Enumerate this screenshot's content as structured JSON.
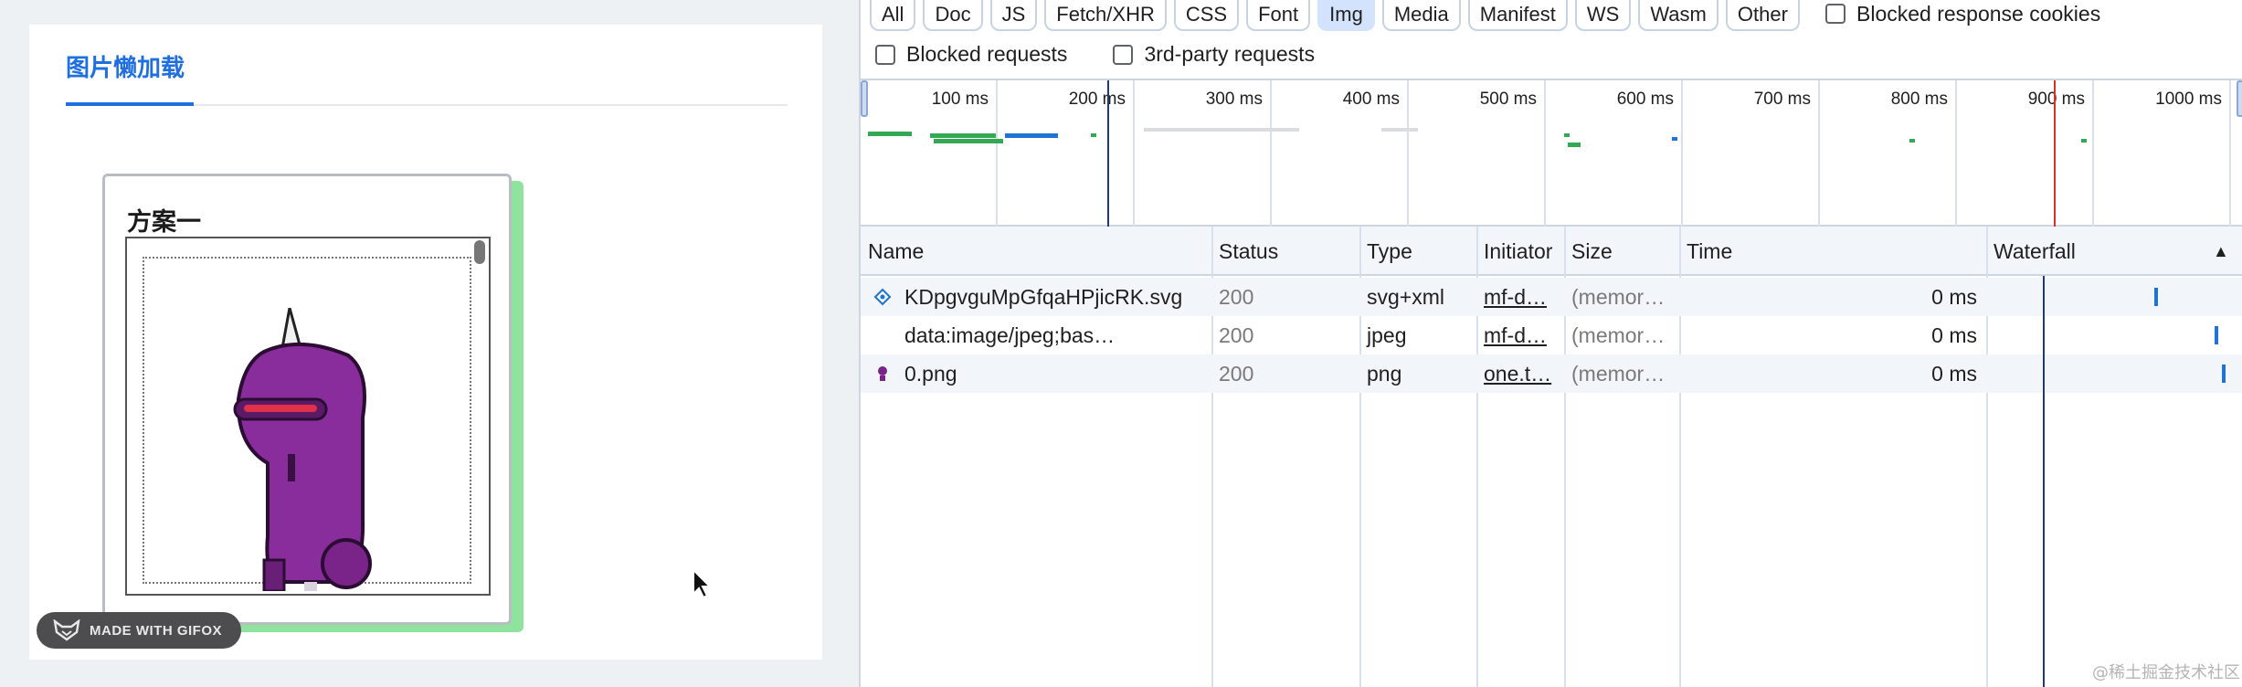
{
  "left": {
    "page_title": "图片懒加载",
    "demo_title": "方案一",
    "gifox_badge": "MADE WITH GIFOX"
  },
  "devtools": {
    "filters": [
      "All",
      "Doc",
      "JS",
      "Fetch/XHR",
      "CSS",
      "Font",
      "Img",
      "Media",
      "Manifest",
      "WS",
      "Wasm",
      "Other"
    ],
    "active_filter": "Img",
    "checkboxes": {
      "blocked_response_cookies": "Blocked response cookies",
      "blocked_requests": "Blocked requests",
      "third_party_requests": "3rd-party requests"
    },
    "timeline_ticks": [
      "100 ms",
      "200 ms",
      "300 ms",
      "400 ms",
      "500 ms",
      "600 ms",
      "700 ms",
      "800 ms",
      "900 ms",
      "1000 ms"
    ],
    "columns": {
      "name": "Name",
      "status": "Status",
      "type": "Type",
      "initiator": "Initiator",
      "size": "Size",
      "time": "Time",
      "waterfall": "Waterfall",
      "sort_indicator": "▲"
    },
    "rows": [
      {
        "icon": "svg-file-icon",
        "name": "KDpgvguMpGfqaHPjicRK.svg",
        "status": "200",
        "type": "svg+xml",
        "initiator": "mf-d…",
        "size": "(memor…",
        "time": "0 ms"
      },
      {
        "icon": "",
        "name": "data:image/jpeg;bas…",
        "status": "200",
        "type": "jpeg",
        "initiator": "mf-d…",
        "size": "(memor…",
        "time": "0 ms"
      },
      {
        "icon": "png-file-icon",
        "name": "0.png",
        "status": "200",
        "type": "png",
        "initiator": "one.t…",
        "size": "(memor…",
        "time": "0 ms"
      }
    ]
  },
  "watermark": "@稀土掘金技术社区",
  "colors": {
    "accent_blue": "#1f6fe0",
    "green_shadow": "#8fe39f",
    "active_chip": "#d3e3fd",
    "waterfall_bar": "#1f73d2"
  }
}
